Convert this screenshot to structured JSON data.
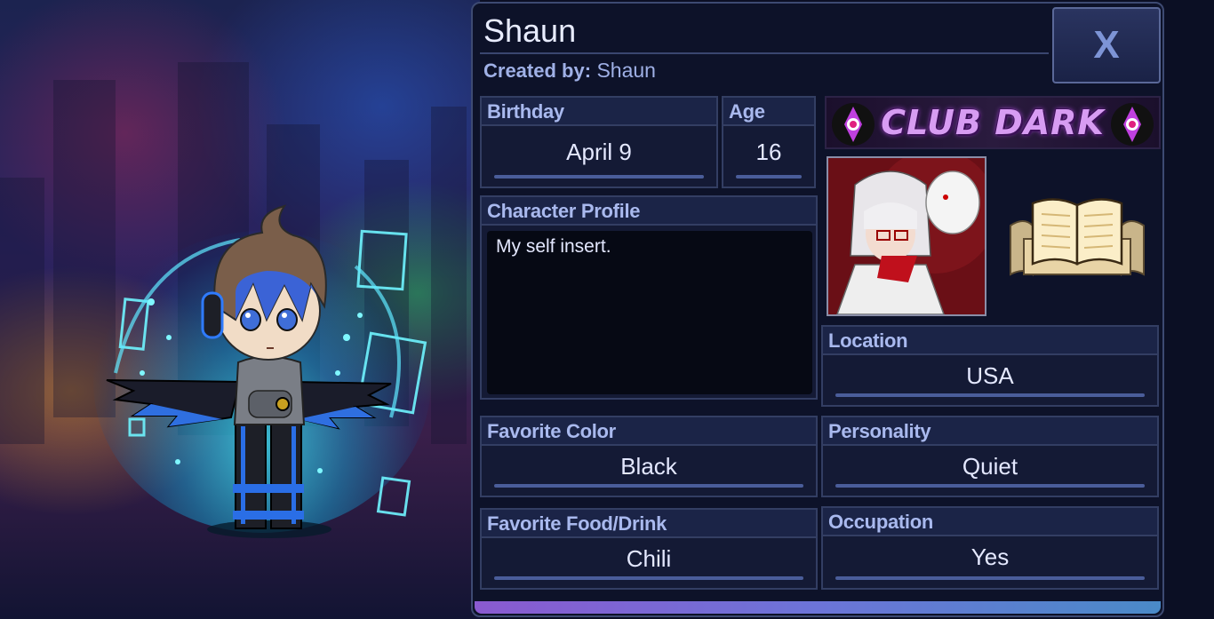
{
  "character": {
    "name": "Shaun",
    "created_by_label": "Created by:",
    "created_by": "Shaun"
  },
  "close_button": {
    "label": "X"
  },
  "fields": {
    "birthday": {
      "label": "Birthday",
      "value": "April 9"
    },
    "age": {
      "label": "Age",
      "value": "16"
    },
    "profile": {
      "label": "Character Profile",
      "value": "My self insert."
    },
    "location": {
      "label": "Location",
      "value": "USA"
    },
    "favorite_color": {
      "label": "Favorite Color",
      "value": "Black"
    },
    "personality": {
      "label": "Personality",
      "value": "Quiet"
    },
    "favorite_food": {
      "label": "Favorite Food/Drink",
      "value": "Chili"
    },
    "occupation": {
      "label": "Occupation",
      "value": "Yes"
    }
  },
  "banner": {
    "text": "CLUB DARK"
  },
  "icons": {
    "close": "close-icon",
    "book": "open-book-icon",
    "emblem": "club-emblem-icon"
  },
  "colors": {
    "panel_bg": "#0d1229",
    "header_text": "#a9b9ee",
    "value_text": "#e4e8ff",
    "accent_glow": "#3cf0ff",
    "banner_text": "#d79cf2"
  }
}
